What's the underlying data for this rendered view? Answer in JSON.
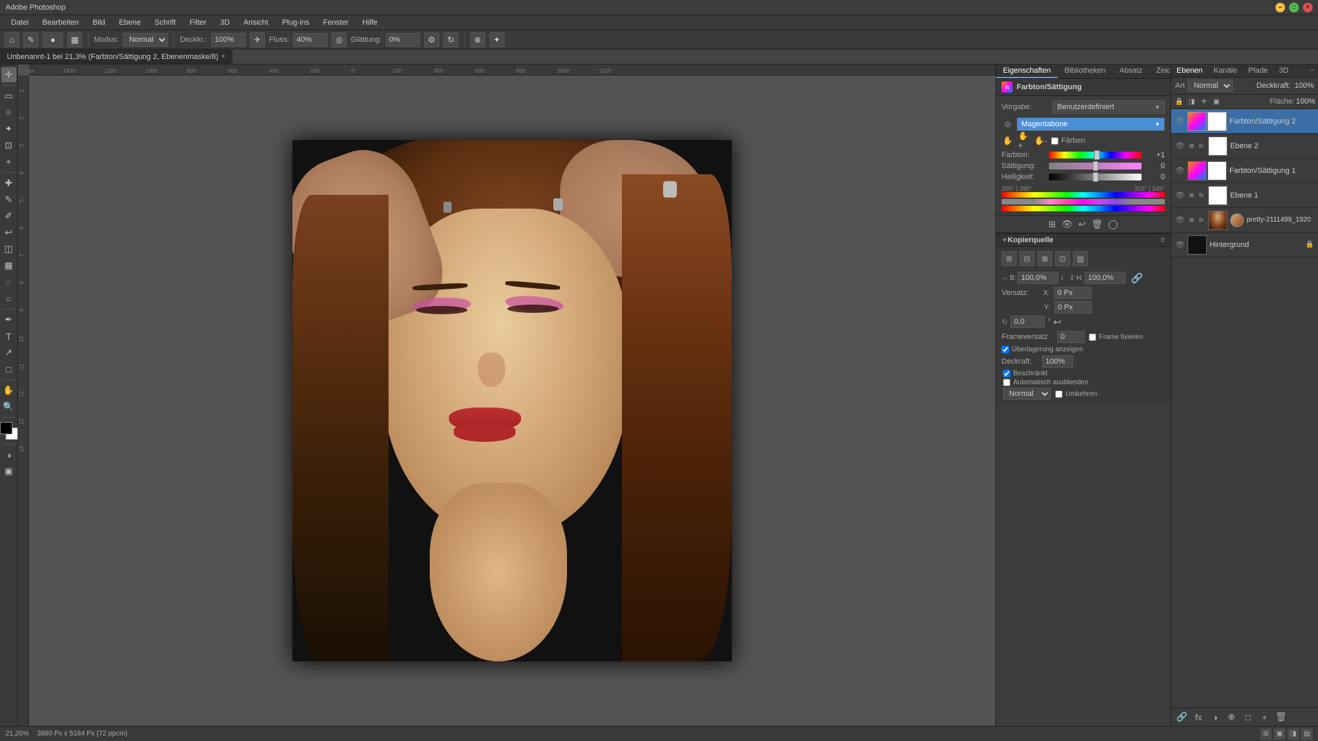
{
  "window": {
    "title": "Adobe Photoshop",
    "controls": [
      "minimize",
      "maximize",
      "close"
    ]
  },
  "menubar": {
    "items": [
      "Datei",
      "Bearbeiten",
      "Bild",
      "Ebene",
      "Schrift",
      "Filter",
      "3D",
      "Ansicht",
      "Plug-ins",
      "Fenster",
      "Hilfe"
    ]
  },
  "optionsbar": {
    "mode_label": "Modus:",
    "mode_value": "Normal",
    "opacity_label": "Deckkr.:",
    "opacity_value": "100%",
    "flow_label": "Fluss:",
    "flow_value": "40%",
    "smooth_label": "Glättung:",
    "smooth_value": "0%"
  },
  "tab": {
    "name": "Unbenannt-1 bei 21,3% (Farbton/Sättigung 2, Ebenenmaske/8)",
    "close_symbol": "×"
  },
  "properties_panel": {
    "tabs": [
      "Eigenschaften",
      "Bibliotheken",
      "Absatz",
      "Zeichen"
    ],
    "active_tab": "Eigenschaften",
    "title": "Farbton/Sättigung",
    "preset_label": "Vorgabe:",
    "preset_value": "Benutzerdefiniert",
    "channel_value": "Magentabone",
    "farbton_label": "Farbton:",
    "farbton_value": "+1",
    "saettigung_label": "Sättigung:",
    "saettigung_value": "0",
    "helligkeit_label": "Helligkeit:",
    "helligkeit_value": "0",
    "faerben_label": "Färben",
    "range_left": "255° | 285°",
    "range_right": "315° | 345°"
  },
  "layers_panel": {
    "tabs": [
      "Ebenen",
      "Kanäle",
      "Pfade",
      "3D"
    ],
    "active_tab": "Ebenen",
    "mode_label": "Art",
    "mode_value": "Normal",
    "opacity_label": "Deckkraft:",
    "opacity_value": "100%",
    "fill_label": "Fläche:",
    "fill_value": "100%",
    "layers": [
      {
        "name": "Farbton/Sättigung 2",
        "type": "adjustment",
        "visible": true,
        "locked": false,
        "has_mask": true
      },
      {
        "name": "Ebene 2",
        "type": "regular",
        "visible": true,
        "locked": false,
        "has_mask": false
      },
      {
        "name": "Farbton/Sättigung 1",
        "type": "adjustment",
        "visible": true,
        "locked": false,
        "has_mask": true
      },
      {
        "name": "Ebene 1",
        "type": "regular",
        "visible": true,
        "locked": false,
        "has_mask": false
      },
      {
        "name": "pretty-2111499_1920",
        "type": "photo",
        "visible": true,
        "locked": false,
        "has_mask": false
      },
      {
        "name": "Hintergrund",
        "type": "background",
        "visible": true,
        "locked": true,
        "has_mask": false
      }
    ]
  },
  "kopierquelle_panel": {
    "title": "Kopierquelle",
    "breite_label": "B:",
    "breite_value": "100,0%",
    "hoehe_label": "H:",
    "hoehe_value": "100,0%",
    "versatz_label": "Versatz:",
    "x_label": "X:",
    "x_value": "0 Px",
    "y_label": "Y:",
    "y_value": "0 Px",
    "winkel_value": "0,0",
    "frameversatz_label": "Frameversatz",
    "frameversatz_value": "0",
    "frame_fixieren_label": "Frame fixieren",
    "ueberlagerung_label": "Überlagerung anzeigen",
    "deckraft_label": "Deckraft:",
    "deckraft_value": "100%",
    "beschraenkt_label": "Beschränkt",
    "auto_ausblenden_label": "Automatisch ausblenden",
    "mode_value": "Normal",
    "umkehren_label": "Umkehren"
  },
  "statusbar": {
    "zoom": "21,26%",
    "dimensions": "3880 Px x 5184 Px (72 ppcm)"
  },
  "second_panel": {
    "mode_value": "Normal",
    "opacity_label": "Deckkraft:",
    "opacity_value": "100%"
  }
}
